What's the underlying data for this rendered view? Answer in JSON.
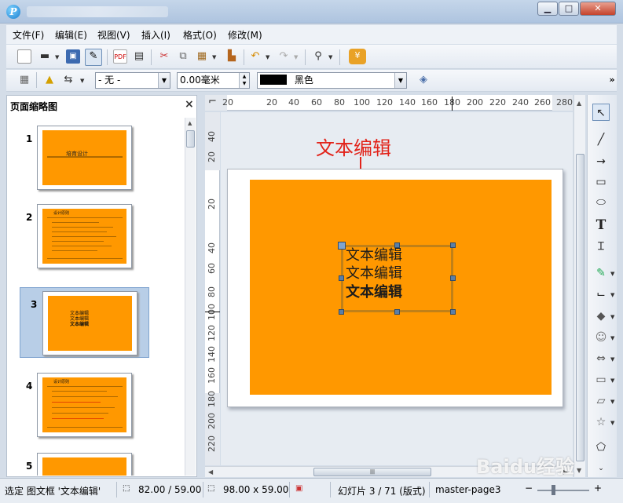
{
  "menu": [
    "文件(F)",
    "编辑(E)",
    "视图(V)",
    "插入(I)",
    "格式(O)",
    "修改(M)"
  ],
  "toolbar2": {
    "line_style": "- 无 -",
    "line_width": "0.00毫米",
    "line_color": "黑色"
  },
  "pane": {
    "title": "页面缩略图",
    "slides": [
      {
        "number": "1",
        "title": "培育设计"
      },
      {
        "number": "2",
        "title": "设计原则"
      },
      {
        "number": "3",
        "lines": [
          "文本编辑",
          "文本编辑",
          "文本编辑"
        ]
      },
      {
        "number": "4",
        "title": "设计原则"
      },
      {
        "number": "5"
      }
    ]
  },
  "ruler": {
    "h_labels": [
      "20",
      "20",
      "40",
      "60",
      "80",
      "100",
      "120",
      "140",
      "160",
      "180",
      "200",
      "220",
      "240",
      "260",
      "280"
    ],
    "v_labels": [
      "40",
      "20",
      "20",
      "40",
      "60",
      "80",
      "100",
      "120",
      "140",
      "160",
      "180",
      "200",
      "220",
      "240"
    ]
  },
  "canvas": {
    "annotation": "文本编辑",
    "text_lines": [
      "文本编辑",
      "文本编辑",
      "文本编辑"
    ]
  },
  "status": {
    "selection": "选定 图文框 '文本编辑'",
    "position": "82.00 / 59.00",
    "size": "98.00 x 59.00",
    "slide": "幻灯片 3 / 71 (版式)",
    "master": "master-page3"
  },
  "watermark": "Baidu经验",
  "colors": {
    "slide_bg": "#ff9800",
    "annotation": "#e2231a",
    "line_color_swatch": "#000000"
  }
}
